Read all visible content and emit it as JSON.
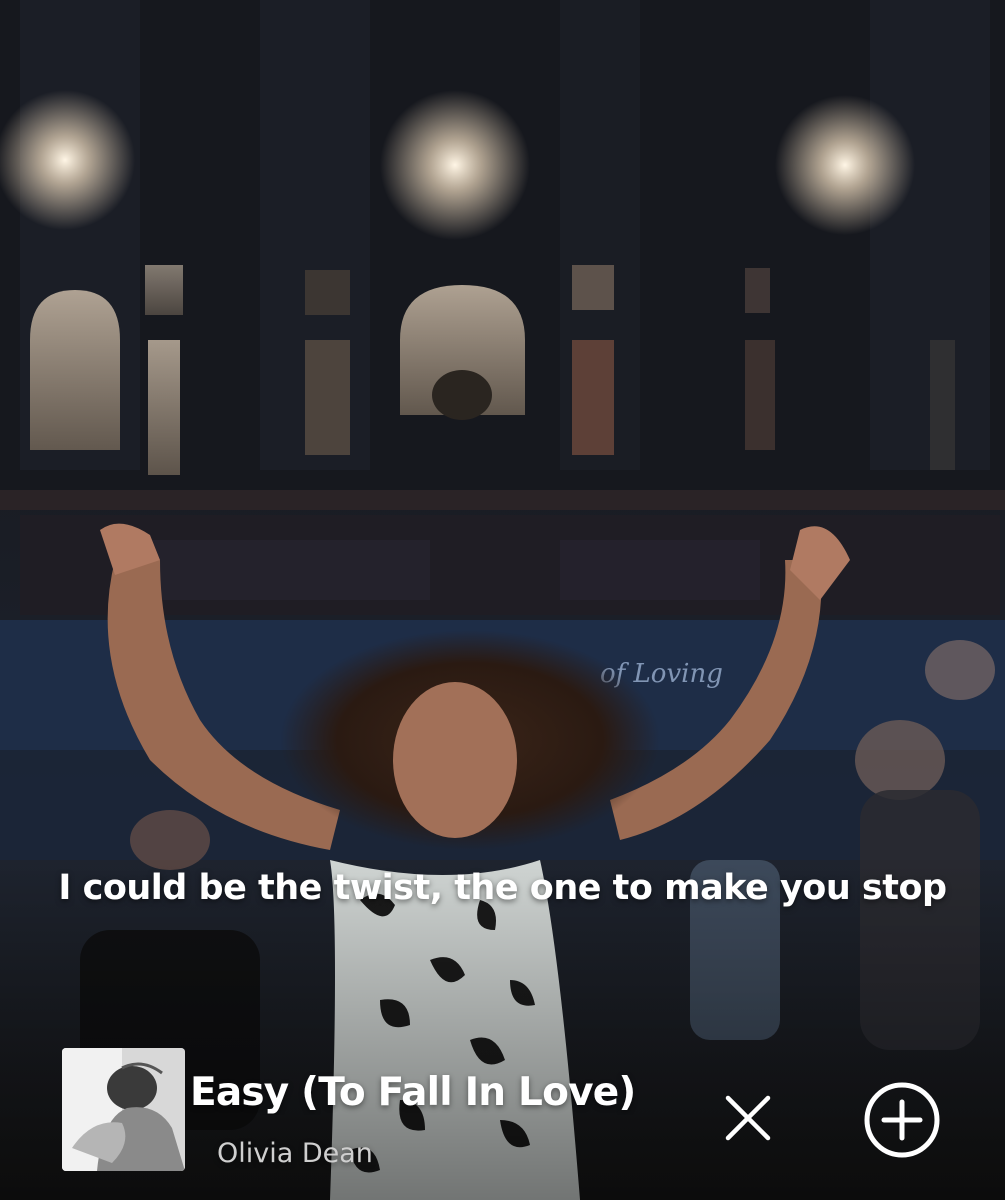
{
  "lyrics": {
    "current_line": "I could be the twist, the one to make you stop"
  },
  "now_playing": {
    "title": "Easy (To Fall In Love)",
    "artist": "Olivia Dean",
    "artwork_icon": "album-art"
  },
  "controls": {
    "close_icon": "close-icon",
    "add_icon": "add-circle-icon"
  },
  "background": {
    "sign_text": "of Loving"
  },
  "colors": {
    "text_primary": "#ffffff",
    "text_secondary": "#cfcfcf",
    "background": "#14161c"
  }
}
